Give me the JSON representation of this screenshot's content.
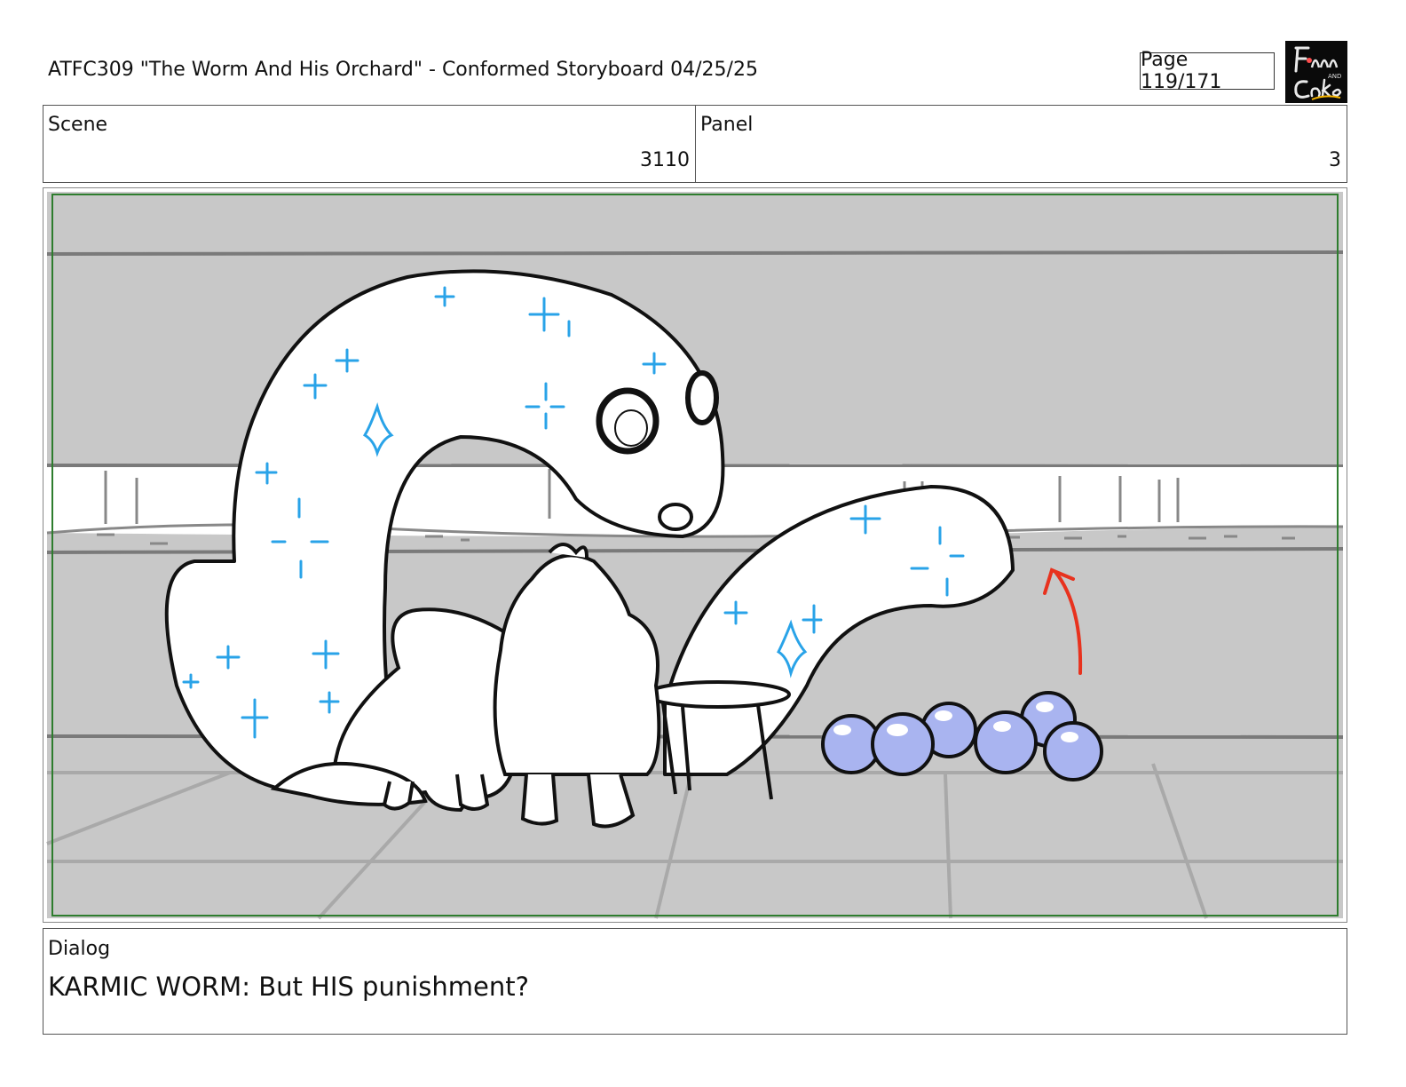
{
  "header": {
    "title": "ATFC309 \"The Worm And His Orchard\" - Conformed Storyboard 04/25/25",
    "page": "Page 119/171",
    "logo_icon": "fionna-and-cake-logo"
  },
  "info": {
    "scene_label": "Scene",
    "scene_value": "3110",
    "panel_label": "Panel",
    "panel_value": "3"
  },
  "panel_image": {
    "background_color": "#c8c8c8",
    "safe_frame_color": "#2e7d2e",
    "sparkle_color": "#29a3e8",
    "orb_color": "#a9b4f0",
    "arrow_color": "#e8321e"
  },
  "dialog": {
    "label": "Dialog",
    "text": "KARMIC WORM: But HIS punishment?"
  }
}
